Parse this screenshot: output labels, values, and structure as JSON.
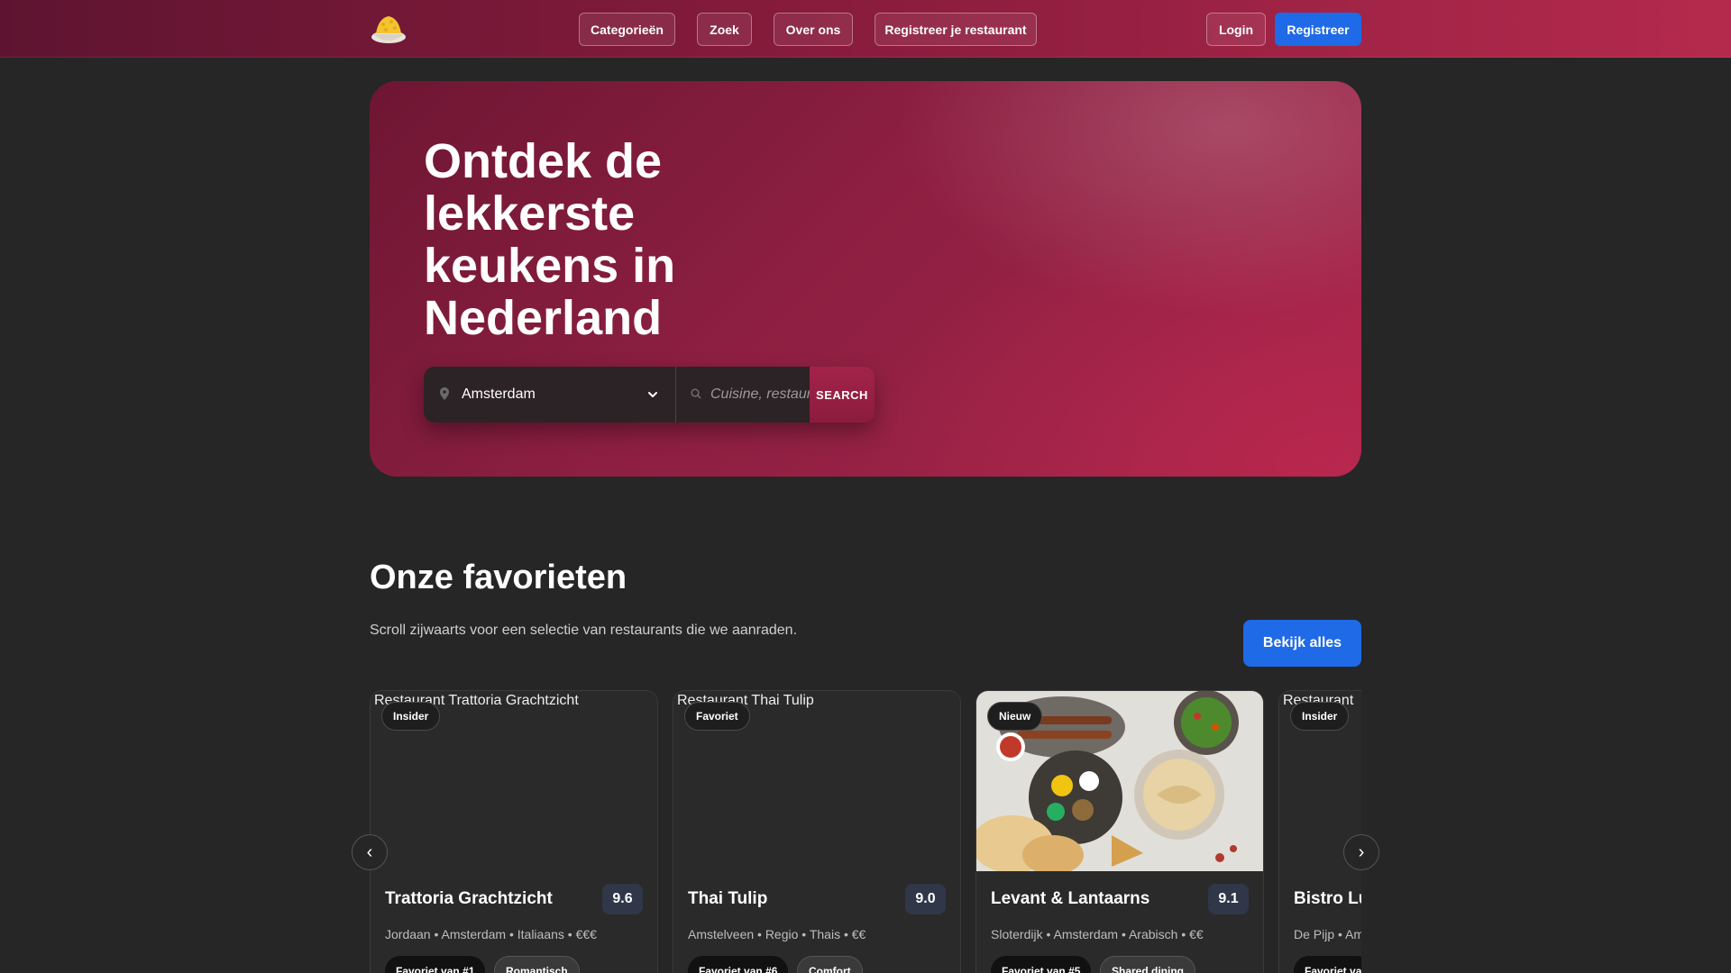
{
  "header": {
    "logo_icon": "rice-bowl-icon",
    "nav": [
      {
        "label": "Categorieën"
      },
      {
        "label": "Zoek"
      },
      {
        "label": "Over ons"
      },
      {
        "label": "Registreer je restaurant"
      }
    ],
    "login_label": "Login",
    "register_label": "Registreer",
    "accent_color": "#1f6ae6"
  },
  "hero": {
    "title": "Ontdek de lekkerste keukens in Nederland",
    "city": {
      "icon": "map-pin-icon",
      "value": "Amsterdam"
    },
    "query": {
      "icon": "search-icon",
      "placeholder": "Cuisine, restaurant..."
    },
    "search_label": "SEARCH"
  },
  "favorites": {
    "title": "Onze favorieten",
    "subtitle": "Scroll zijwaarts voor een selectie van restaurants die we aanraden.",
    "view_all_label": "Bekijk alles",
    "prev_label": "‹",
    "next_label": "›",
    "cards": [
      {
        "alt": "Restaurant Trattoria Grachtzicht",
        "badge": "Insider",
        "name": "Trattoria Grachtzicht",
        "score": "9.6",
        "meta": "Jordaan • Amsterdam  •  Italiaans  •  €€€",
        "tags": [
          "Favoriet van #1",
          "Romantisch"
        ]
      },
      {
        "alt": "Restaurant Thai Tulip",
        "badge": "Favoriet",
        "name": "Thai Tulip",
        "score": "9.0",
        "meta": "Amstelveen • Regio  •  Thais  •  €€",
        "tags": [
          "Favoriet van #6",
          "Comfort"
        ]
      },
      {
        "alt": "",
        "badge": "Nieuw",
        "name": "Levant & Lantaarns",
        "score": "9.1",
        "meta": "Sloterdijk • Amsterdam  •  Arabisch  •  €€",
        "tags": [
          "Favoriet van #5",
          "Shared dining"
        ]
      },
      {
        "alt": "Restaurant",
        "badge": "Insider",
        "name": "Bistro Lu",
        "score": "",
        "meta": "De Pijp • Am",
        "tags": [
          "Favoriet va"
        ]
      }
    ]
  }
}
